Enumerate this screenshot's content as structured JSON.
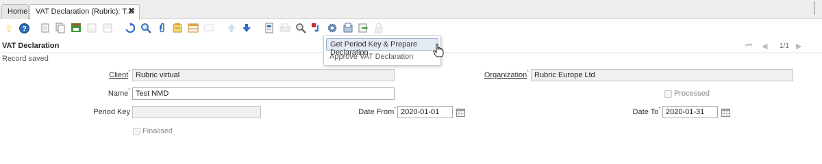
{
  "tabs": [
    {
      "label": "Home"
    },
    {
      "label": "VAT Declaration (Rubric): T...",
      "close": "✖"
    }
  ],
  "toolbar": {
    "icons": [
      "lamp-icon",
      "help-icon",
      "new-record-icon",
      "copy-record-icon",
      "save-icon",
      "delete-icon",
      "delete-selection-icon",
      "refresh-icon",
      "find-icon",
      "attachment-icon",
      "notes-icon",
      "grid-toggle-icon",
      "chat-icon",
      "previous-record-icon",
      "next-record-icon",
      "report-icon",
      "print-icon",
      "zoom-across-icon",
      "workflow-icon",
      "process-icon",
      "archive-icon",
      "export-icon",
      "lock-icon"
    ]
  },
  "window": {
    "title": "VAT Declaration",
    "record_count": "1/1",
    "status": "Record saved"
  },
  "form": {
    "client_label": "Client",
    "client_value": "Rubric virtual",
    "organization_label": "Organization",
    "organization_value": "Rubric Europe Ltd",
    "name_label": "Name",
    "name_value": "Test NMD",
    "processed_label": "Processed",
    "period_key_label": "Period Key",
    "period_key_value": "",
    "date_from_label": "Date From",
    "date_from_value": "2020-01-01",
    "date_to_label": "Date To",
    "date_to_value": "2020-01-31",
    "finalised_label": "Finalised"
  },
  "process_menu": {
    "items": [
      {
        "label": "Get Period Key & Prepare Declaration"
      },
      {
        "label": "Approve VAT Declaration"
      }
    ]
  },
  "colors": {
    "accent_blue": "#2f6fbf",
    "menu_highlight": "#e4eaf3",
    "readonly_bg": "#f0f0f0"
  }
}
